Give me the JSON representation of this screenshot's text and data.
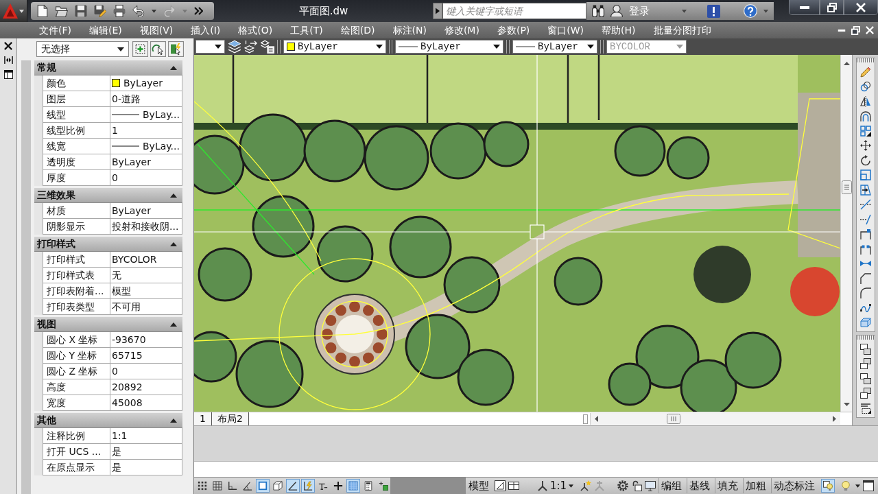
{
  "title_bar": {
    "title": "平面图.dw",
    "search": {
      "placeholder": "键入关键字或短语"
    },
    "sign_in": "登录"
  },
  "menu_bar": {
    "items": [
      "文件(F)",
      "编辑(E)",
      "视图(V)",
      "插入(I)",
      "格式(O)",
      "工具(T)",
      "绘图(D)",
      "标注(N)",
      "修改(M)",
      "参数(P)",
      "窗口(W)",
      "帮助(H)",
      "批量分图打印"
    ]
  },
  "toolbar": {
    "combos": [
      {
        "kind": "color",
        "label": "ByLayer",
        "color": "#ffff00",
        "disabled": false
      },
      {
        "kind": "linetype",
        "label": "ByLayer",
        "disabled": false
      },
      {
        "kind": "linetype",
        "label": "ByLayer",
        "disabled": false
      },
      {
        "kind": "text",
        "label": "BYCOLOR",
        "disabled": true
      }
    ]
  },
  "properties": {
    "selection": "无选择",
    "sections": [
      {
        "title": "常规",
        "expanded": true,
        "rows": [
          {
            "kind": "color",
            "label": "颜色",
            "value": "ByLayer",
            "color": "#ffff00"
          },
          {
            "kind": "text",
            "label": "图层",
            "value": "0-道路"
          },
          {
            "kind": "linetype",
            "label": "线型",
            "value": "ByLay..."
          },
          {
            "kind": "text",
            "label": "线型比例",
            "value": "1"
          },
          {
            "kind": "linetype",
            "label": "线宽",
            "value": "ByLay..."
          },
          {
            "kind": "text",
            "label": "透明度",
            "value": "ByLayer"
          },
          {
            "kind": "text",
            "label": "厚度",
            "value": "0"
          }
        ]
      },
      {
        "title": "三维效果",
        "expanded": true,
        "rows": [
          {
            "kind": "text",
            "label": "材质",
            "value": "ByLayer"
          },
          {
            "kind": "text",
            "label": "阴影显示",
            "value": "投射和接收阴..."
          }
        ]
      },
      {
        "title": "打印样式",
        "expanded": true,
        "rows": [
          {
            "kind": "text",
            "label": "打印样式",
            "value": "BYCOLOR"
          },
          {
            "kind": "text",
            "label": "打印样式表",
            "value": "无"
          },
          {
            "kind": "text",
            "label": "打印表附着...",
            "value": "模型"
          },
          {
            "kind": "text",
            "label": "打印表类型",
            "value": "不可用"
          }
        ]
      },
      {
        "title": "视图",
        "expanded": true,
        "rows": [
          {
            "kind": "text",
            "label": "圆心 X 坐标",
            "value": "-93670"
          },
          {
            "kind": "text",
            "label": "圆心 Y 坐标",
            "value": "65715"
          },
          {
            "kind": "text",
            "label": "圆心 Z 坐标",
            "value": "0"
          },
          {
            "kind": "text",
            "label": "高度",
            "value": "20892"
          },
          {
            "kind": "text",
            "label": "宽度",
            "value": "45008"
          }
        ]
      },
      {
        "title": "其他",
        "expanded": true,
        "rows": [
          {
            "kind": "text",
            "label": "注释比例",
            "value": "1:1"
          },
          {
            "kind": "text",
            "label": "打开 UCS ...",
            "value": "是"
          },
          {
            "kind": "text",
            "label": "在原点显示",
            "value": "是"
          }
        ]
      }
    ]
  },
  "layout_tabs": [
    {
      "label": "1",
      "selected": false
    },
    {
      "label": "布局2",
      "selected": false
    }
  ],
  "status_bar": {
    "toggles": [
      {
        "on": false
      },
      {
        "on": false
      },
      {
        "on": false
      },
      {
        "on": false
      },
      {
        "on": true
      },
      {
        "on": false
      },
      {
        "on": true
      },
      {
        "on": true
      },
      {
        "on": false
      },
      {
        "on": false
      },
      {
        "on": true
      },
      {
        "on": false
      },
      {
        "on": false
      }
    ],
    "space": "模型",
    "annotation_scale": "1:1",
    "buttons": [
      "编组",
      "基线",
      "填充",
      "加粗",
      "动态标注"
    ],
    "tray_toggles": [
      {
        "on": true
      },
      {
        "on": false
      }
    ]
  }
}
